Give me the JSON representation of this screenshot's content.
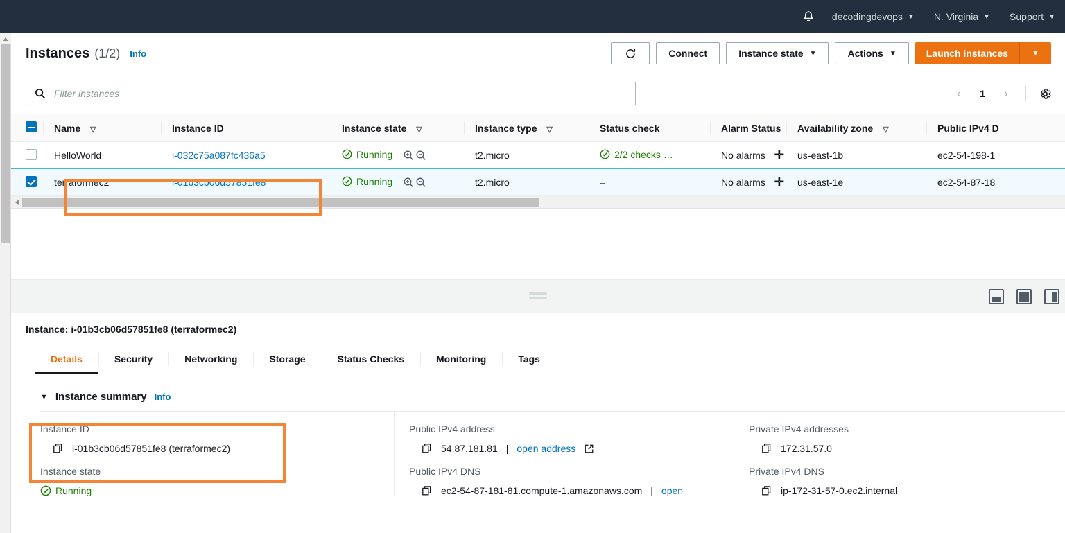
{
  "topnav": {
    "bell_icon": "bell-icon",
    "account": "decodingdevops",
    "region": "N. Virginia",
    "support": "Support",
    "caret": "▼"
  },
  "header": {
    "title": "Instances",
    "count": "(1/2)",
    "info": "Info"
  },
  "toolbar": {
    "refresh_icon": "refresh-icon",
    "connect": "Connect",
    "instance_state": "Instance state",
    "actions": "Actions",
    "launch": "Launch instances",
    "caret": "▼"
  },
  "search": {
    "icon": "search-icon",
    "placeholder": "Filter instances",
    "value": ""
  },
  "pager": {
    "prev": "‹",
    "page": "1",
    "next": "›",
    "gear_icon": "gear-icon"
  },
  "table": {
    "columns": [
      {
        "label": "Name",
        "sortable": true
      },
      {
        "label": "Instance ID",
        "sortable": false
      },
      {
        "label": "Instance state",
        "sortable": true
      },
      {
        "label": "Instance type",
        "sortable": true
      },
      {
        "label": "Status check",
        "sortable": false
      },
      {
        "label": "Alarm Status",
        "sortable": false
      },
      {
        "label": "Availability zone",
        "sortable": true
      },
      {
        "label": "Public IPv4 D",
        "sortable": false
      }
    ],
    "sort_icon": "▽",
    "rows": [
      {
        "selected": false,
        "name": "HelloWorld",
        "instance_id": "i-032c75a087fc436a5",
        "state": "Running",
        "type": "t2.micro",
        "status_check": "2/2 checks …",
        "status_check_ok": true,
        "alarm": "No alarms",
        "az": "us-east-1b",
        "dns": "ec2-54-198-1"
      },
      {
        "selected": true,
        "name": "terraformec2",
        "instance_id": "i-01b3cb06d57851fe8",
        "state": "Running",
        "type": "t2.micro",
        "status_check": "–",
        "status_check_ok": false,
        "alarm": "No alarms",
        "az": "us-east-1e",
        "dns": "ec2-54-87-18"
      }
    ]
  },
  "split_panel": {
    "drag_handle": "drag-handle",
    "layout_icons": [
      "panel-bottom-icon",
      "panel-center-icon",
      "panel-side-icon"
    ]
  },
  "detail": {
    "title": "Instance: i-01b3cb06d57851fe8 (terraformec2)",
    "tabs": [
      {
        "label": "Details",
        "active": true
      },
      {
        "label": "Security",
        "active": false
      },
      {
        "label": "Networking",
        "active": false
      },
      {
        "label": "Storage",
        "active": false
      },
      {
        "label": "Status Checks",
        "active": false
      },
      {
        "label": "Monitoring",
        "active": false
      },
      {
        "label": "Tags",
        "active": false
      }
    ],
    "summary": {
      "triangle": "▼",
      "heading": "Instance summary",
      "info": "Info",
      "fields": {
        "instance_id_label": "Instance ID",
        "instance_id_value": "i-01b3cb06d57851fe8 (terraformec2)",
        "instance_state_label": "Instance state",
        "instance_state_value": "Running",
        "public_ipv4_label": "Public IPv4 address",
        "public_ipv4_value": "54.87.181.81",
        "public_ipv4_sep": "|",
        "public_ipv4_link": "open address",
        "public_dns_label": "Public IPv4 DNS",
        "public_dns_value": "ec2-54-87-181-81.compute-1.amazonaws.com",
        "public_dns_sep": "|",
        "public_dns_link": "open",
        "private_ipv4_label": "Private IPv4 addresses",
        "private_ipv4_value": "172.31.57.0",
        "private_dns_label": "Private IPv4 DNS",
        "private_dns_value": "ip-172-31-57-0.ec2.internal"
      }
    }
  },
  "colors": {
    "nav_bg": "#232f3e",
    "accent_orange": "#ec7211",
    "annotation_orange": "#f58536",
    "link_blue": "#0073bb",
    "running_green": "#1d8102",
    "selected_row": "#f1faff"
  }
}
